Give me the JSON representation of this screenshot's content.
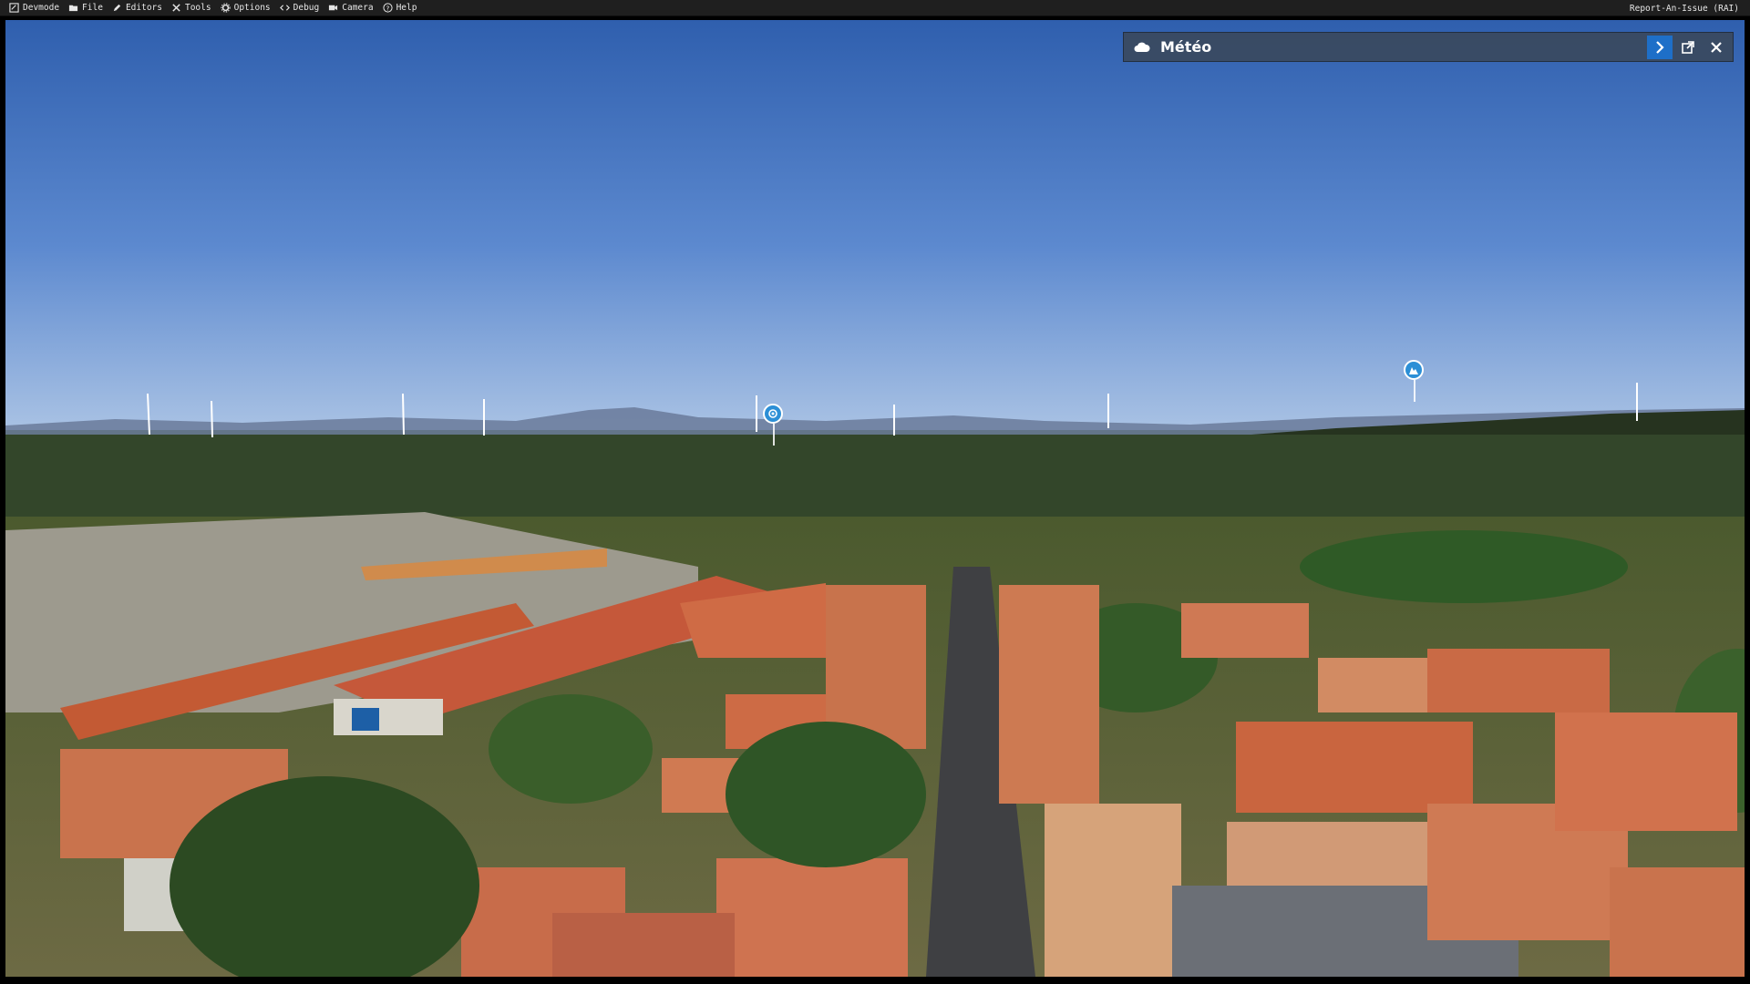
{
  "menubar": {
    "items": [
      {
        "label": "Devmode",
        "icon": "devmode-icon"
      },
      {
        "label": "File",
        "icon": "folder-icon"
      },
      {
        "label": "Editors",
        "icon": "pencil-icon"
      },
      {
        "label": "Tools",
        "icon": "tools-icon"
      },
      {
        "label": "Options",
        "icon": "gear-icon"
      },
      {
        "label": "Debug",
        "icon": "code-icon"
      },
      {
        "label": "Camera",
        "icon": "camera-icon"
      },
      {
        "label": "Help",
        "icon": "help-icon"
      }
    ],
    "right_label": "Report-An-Issue (RAI)"
  },
  "weather_panel": {
    "title": "Météo",
    "icon": "cloud-icon",
    "actions": [
      "chevron-right-icon",
      "external-window-icon",
      "close-icon"
    ],
    "accent": "#1e6fc8"
  },
  "scene": {
    "poi_markers": [
      "target-poi-icon",
      "landmark-poi-icon"
    ],
    "poi_color": "#2c8fd6"
  }
}
